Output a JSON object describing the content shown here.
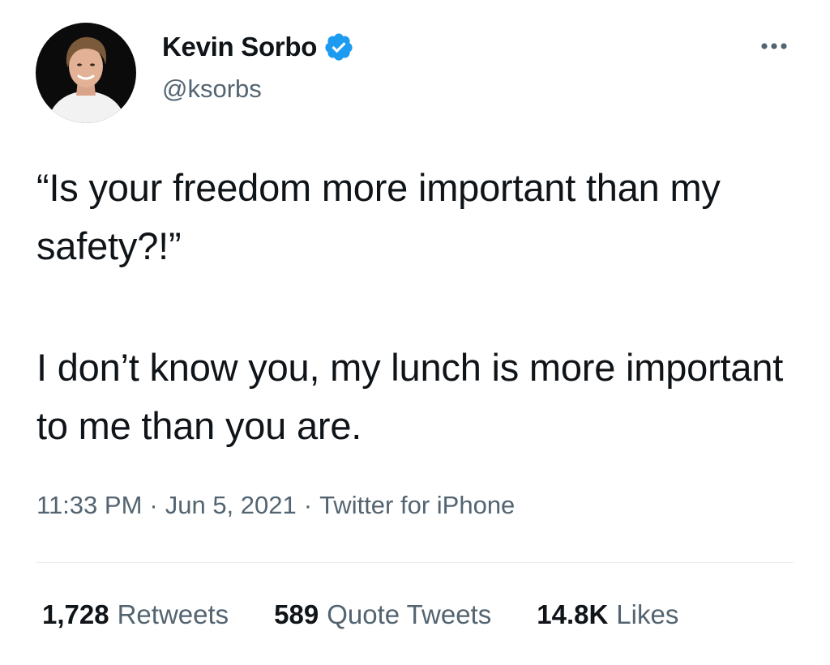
{
  "author": {
    "display_name": "Kevin Sorbo",
    "handle": "@ksorbs",
    "verified": true,
    "verified_icon": "verified-badge-icon",
    "verified_color": "#1d9bf0"
  },
  "more_icon": "more-options-icon",
  "tweet": {
    "paragraphs": [
      "“Is your freedom more important than my safety?!”",
      "I don’t know you, my lunch is more important to me than you are."
    ],
    "time": "11:33 PM",
    "date": "Jun 5, 2021",
    "source": "Twitter for iPhone",
    "separator": "·"
  },
  "stats": {
    "retweets": {
      "count": "1,728",
      "label": "Retweets"
    },
    "quote_tweets": {
      "count": "589",
      "label": "Quote Tweets"
    },
    "likes": {
      "count": "14.8K",
      "label": "Likes"
    }
  },
  "colors": {
    "text_primary": "#0f1419",
    "text_secondary": "#536471",
    "divider": "#e6ecf0"
  }
}
